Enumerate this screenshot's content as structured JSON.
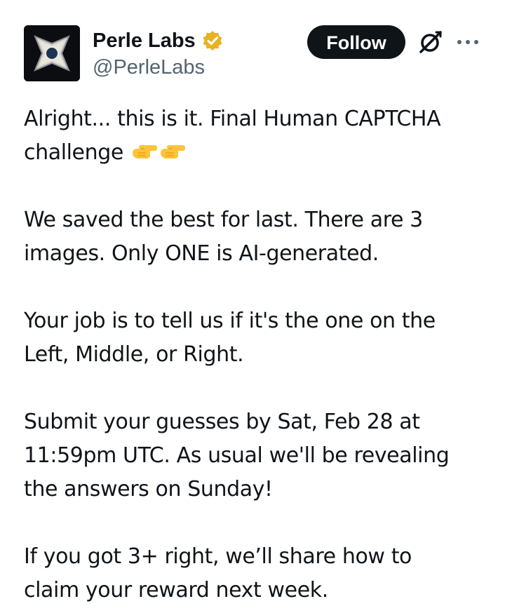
{
  "author": {
    "display_name": "Perle Labs",
    "handle": "@PerleLabs",
    "verified_badge_icon": "gold-verified-badge-icon",
    "avatar_icon": "perle-labs-logo"
  },
  "actions": {
    "follow_label": "Follow",
    "grok_icon": "grok-icon",
    "more_icon": "more-options-icon"
  },
  "tweet": {
    "lines": {
      "l1": "Alright... this is it. Final Human CAPTCHA",
      "l2": "challenge ",
      "p2a": "We saved the best for last. There are 3",
      "p2b": "images. Only ONE is AI-generated.",
      "p3a": "Your job is to tell us if it's the one on the",
      "p3b": "Left, Middle, or Right.",
      "p4a": "Submit your guesses by Sat, Feb 28 at",
      "p4b": "11:59pm UTC. As usual we'll be revealing",
      "p4c": "the answers on Sunday!",
      "p5a": "If you got 3+ right, we’ll share how to",
      "p5b": "claim your reward next week."
    },
    "emojis": [
      "backhand-index-pointing-left-emoji",
      "backhand-index-pointing-left-emoji"
    ]
  },
  "colors": {
    "text_primary": "#0f1419",
    "text_secondary": "#536471",
    "follow_bg": "#0f1419",
    "badge_gold": "#e8b220"
  }
}
